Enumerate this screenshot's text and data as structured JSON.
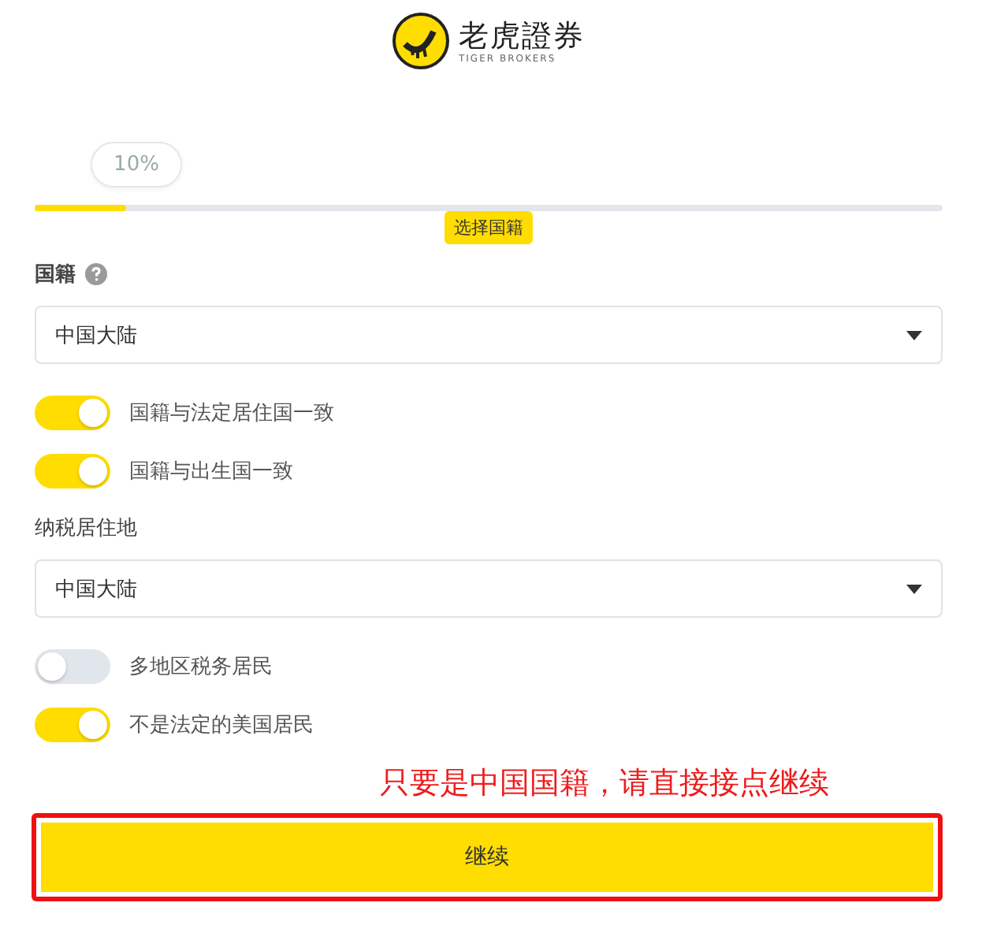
{
  "logo": {
    "name": "老虎證券",
    "subtitle": "TIGER BROKERS"
  },
  "progress": {
    "level": 0.1,
    "reading": "10%",
    "step": "选择国籍"
  },
  "form": [
    {
      "kind": "label",
      "text": "国籍",
      "help": true
    },
    {
      "kind": "select",
      "value": "中国大陆"
    },
    {
      "kind": "toggle",
      "text": "国籍与法定居住国一致",
      "on": true
    },
    {
      "kind": "toggle",
      "text": "国籍与出生国一致",
      "on": true
    },
    {
      "kind": "label",
      "text": "纳税居住地",
      "help": false
    },
    {
      "kind": "select",
      "value": "中国大陆"
    },
    {
      "kind": "toggle",
      "text": "多地区税务居民",
      "on": false
    },
    {
      "kind": "toggle",
      "text": "不是法定的美国居民",
      "on": true
    }
  ],
  "annotation": "只要是中国国籍，请直接接点继续",
  "button": {
    "label": "继续",
    "highlighted": true
  }
}
